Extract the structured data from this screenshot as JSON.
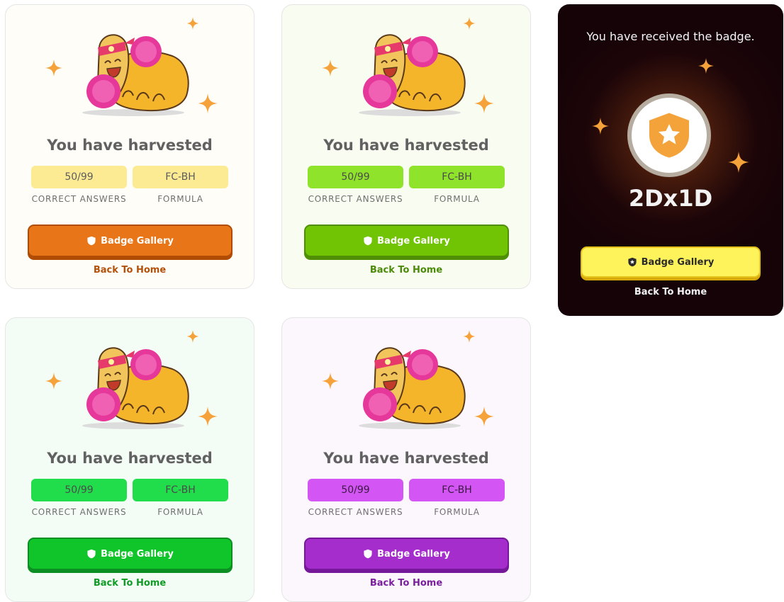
{
  "cards": [
    {
      "title": "You have harvested",
      "stat1_value": "50/99",
      "stat1_label": "CORRECT ANSWERS",
      "stat2_value": "FC-BH",
      "stat2_label": "FORMULA",
      "button_label": "Badge Gallery",
      "back_label": "Back To Home",
      "accent_color": "#e87618"
    },
    {
      "title": "You have harvested",
      "stat1_value": "50/99",
      "stat1_label": "CORRECT ANSWERS",
      "stat2_value": "FC-BH",
      "stat2_label": "FORMULA",
      "button_label": "Badge Gallery",
      "back_label": "Back To Home",
      "accent_color": "#71c404"
    },
    {
      "title": "You have harvested",
      "stat1_value": "50/99",
      "stat1_label": "CORRECT ANSWERS",
      "stat2_value": "FC-BH",
      "stat2_label": "FORMULA",
      "button_label": "Badge Gallery",
      "back_label": "Back To Home",
      "accent_color": "#0fc52a"
    },
    {
      "title": "You have harvested",
      "stat1_value": "50/99",
      "stat1_label": "CORRECT ANSWERS",
      "stat2_value": "FC-BH",
      "stat2_label": "FORMULA",
      "button_label": "Badge Gallery",
      "back_label": "Back To Home",
      "accent_color": "#a52dcc"
    }
  ],
  "badge_modal": {
    "title": "You have received the badge.",
    "badge_name": "2Dx1D",
    "badge_icon": "shield-star-icon",
    "button_label": "Badge Gallery",
    "back_label": "Back To Home",
    "accent_color": "#fff35c"
  }
}
